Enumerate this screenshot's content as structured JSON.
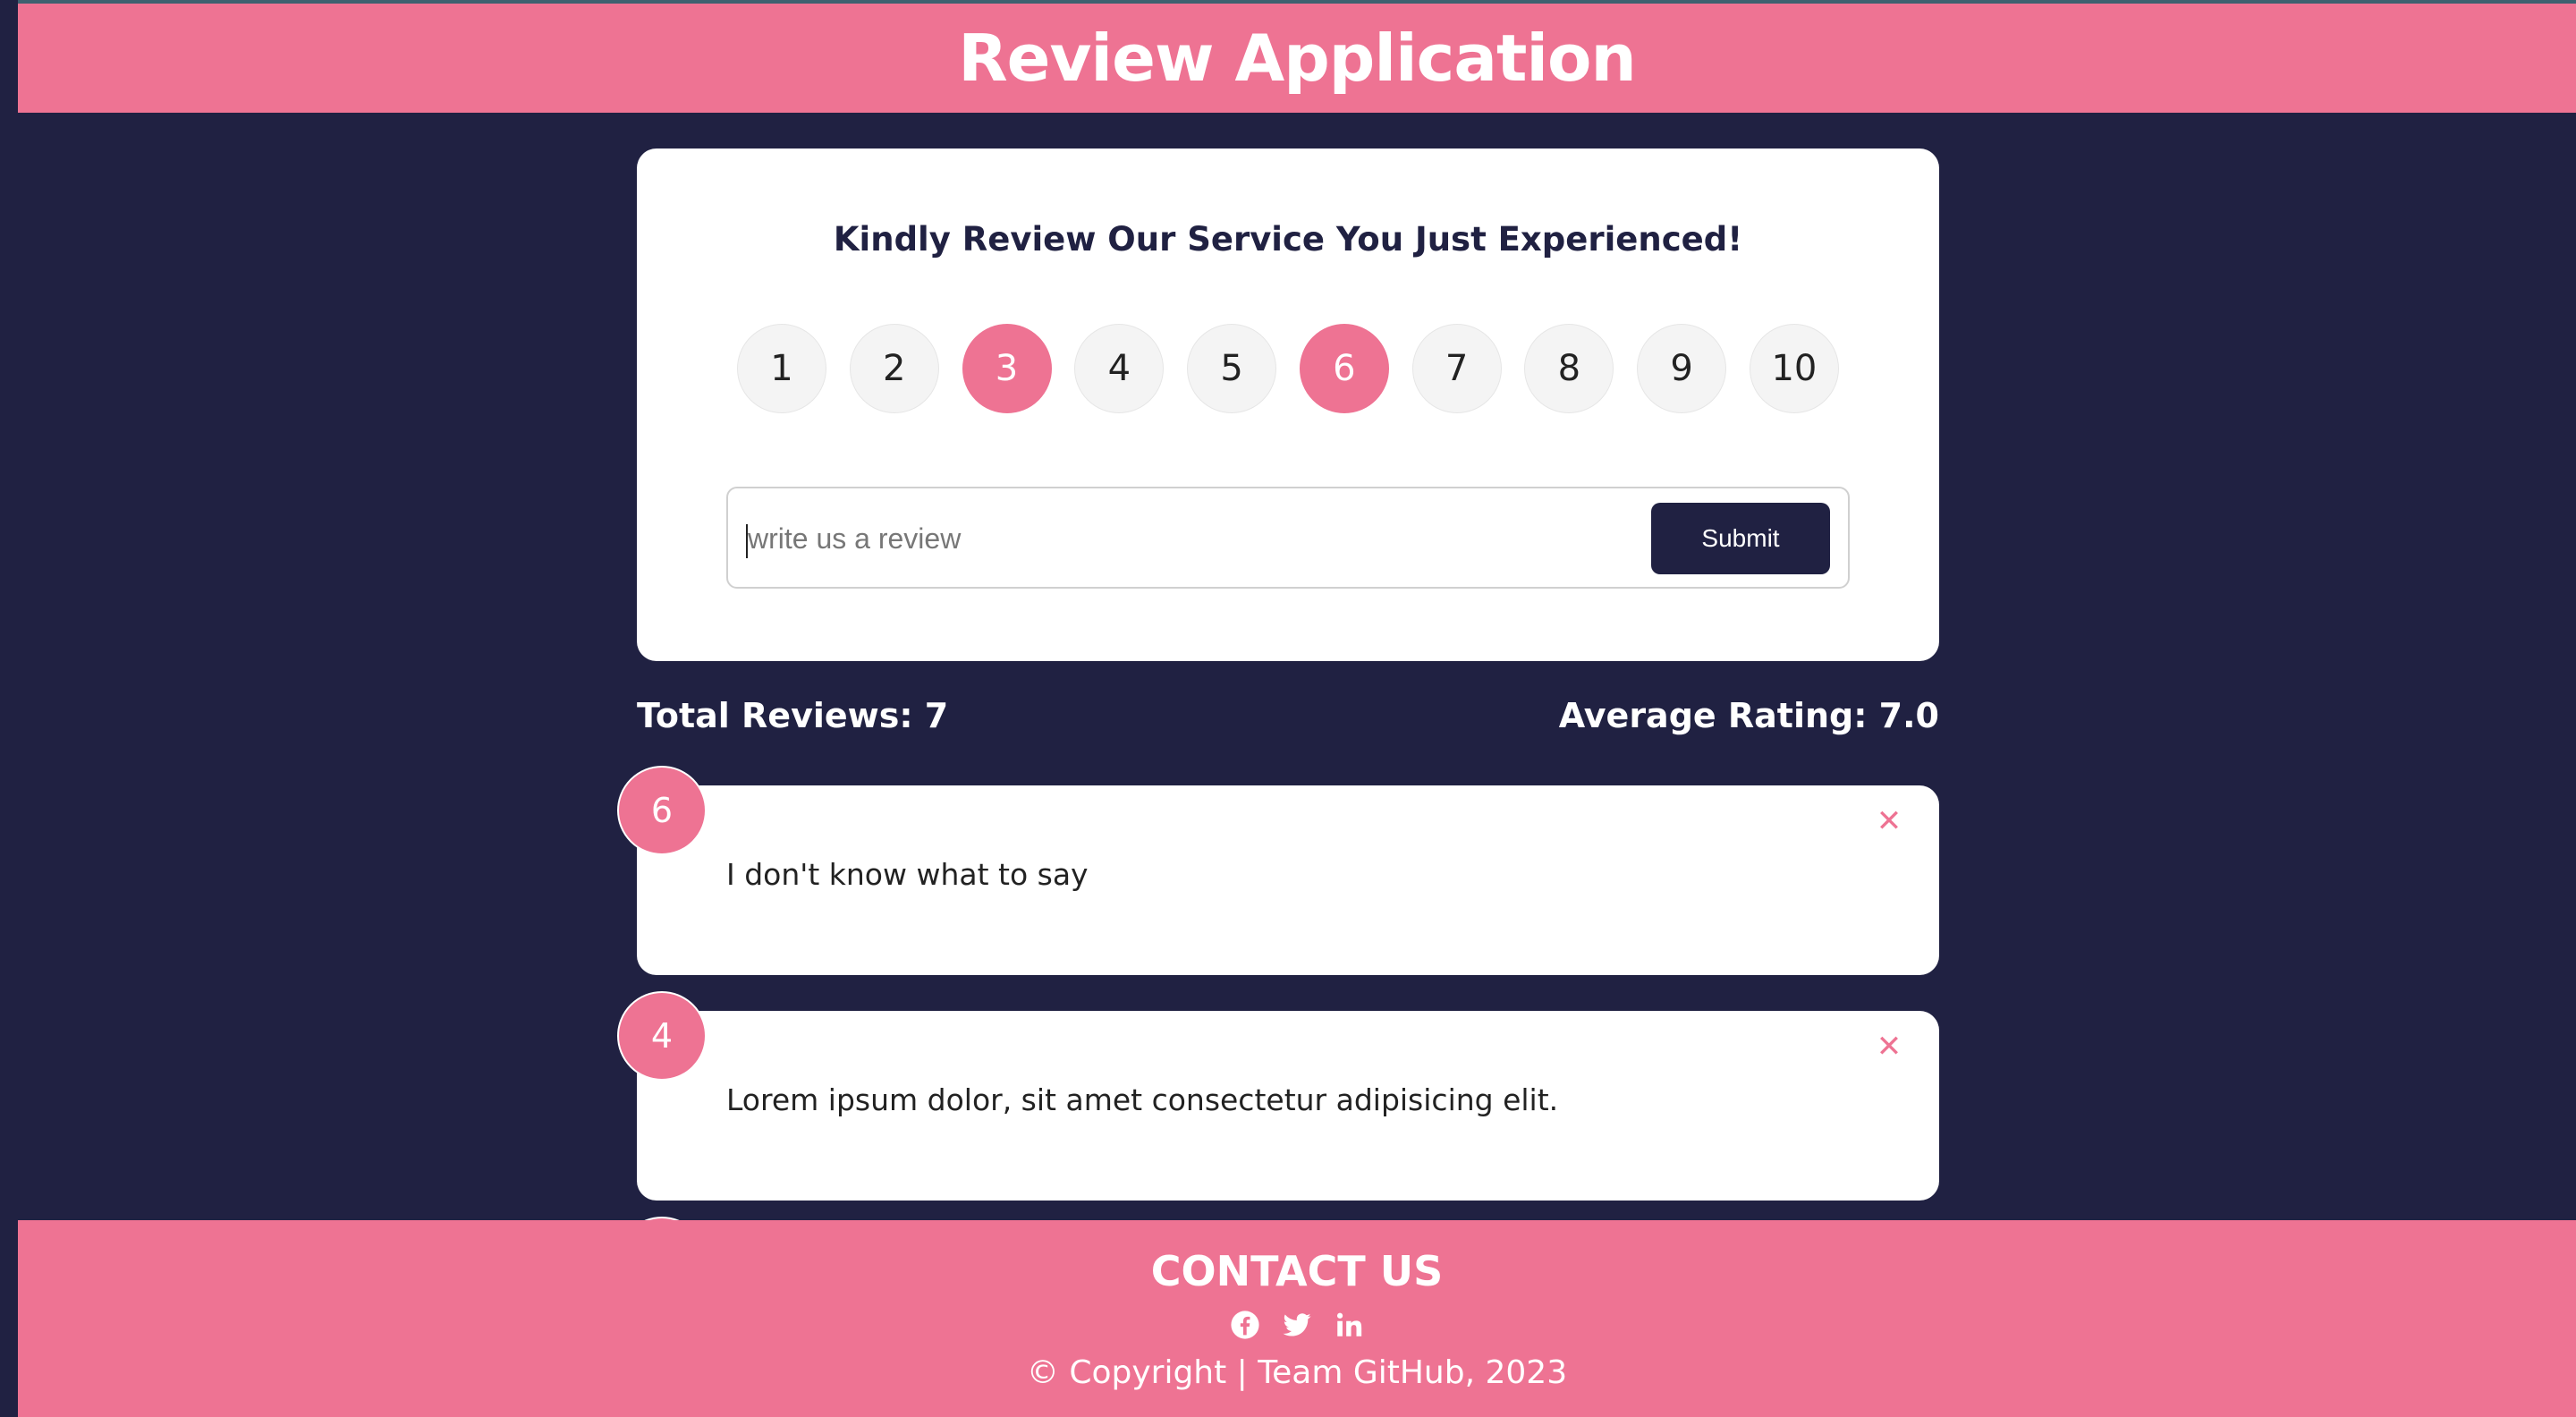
{
  "app": {
    "title": "Review Application"
  },
  "card": {
    "title": "Kindly Review Our Service You Just Experienced!",
    "ratings": [
      "1",
      "2",
      "3",
      "4",
      "5",
      "6",
      "7",
      "8",
      "9",
      "10"
    ],
    "selected_ratings": [
      "3",
      "6"
    ],
    "review_placeholder": "write us a review",
    "review_value": "",
    "submit_label": "Submit"
  },
  "stats": {
    "total_reviews": "Total Reviews: 7",
    "average_rating": "Average Rating: 7.0"
  },
  "reviews": [
    {
      "rating": "6",
      "text": "I don't know what to say"
    },
    {
      "rating": "4",
      "text": "Lorem ipsum dolor, sit amet consectetur adipisicing elit."
    }
  ],
  "footer": {
    "title": "CONTACT US",
    "social_icons": [
      "facebook-icon",
      "twitter-icon",
      "linkedin-icon"
    ],
    "copyright": "© Copyright | Team GitHub, 2023"
  },
  "colors": {
    "accent": "#ee7393",
    "background": "#202142",
    "card": "#ffffff",
    "button": "#202142"
  }
}
